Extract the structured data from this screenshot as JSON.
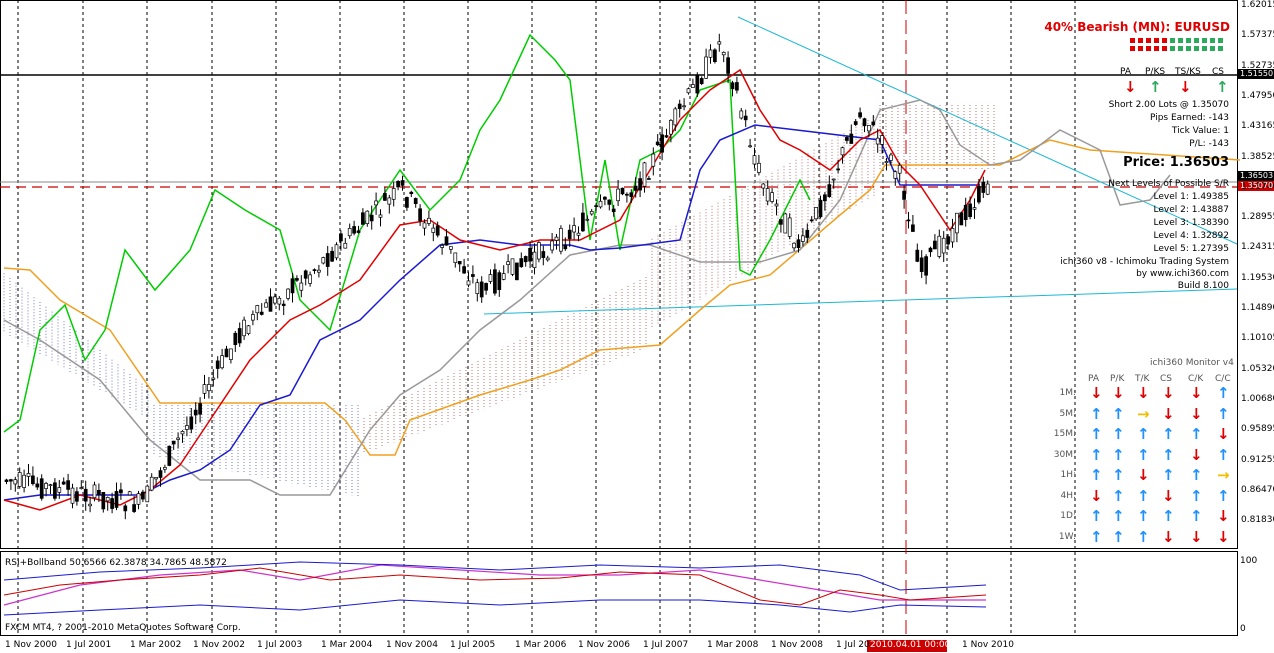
{
  "window": {
    "indicator_label": "RSI+Bollband 50.6566 62.3878 34.7865 48.5872",
    "copyright": "FXCM MT4, ? 2001-2010 MetaQuotes Software Corp.",
    "highlight_date": "2010.04.01 00:00"
  },
  "price_axis": [
    "1.62015",
    "1.57375",
    "1.52735",
    "1.47950",
    "1.43165",
    "1.38525",
    "1.33740",
    "1.28955",
    "1.24315",
    "1.19530",
    "1.14890",
    "1.10105",
    "1.05320",
    "1.00680",
    "0.95895",
    "0.91255",
    "0.86470",
    "0.81830"
  ],
  "price_tags": {
    "current": "1.36503",
    "level_black": "1.51550",
    "level_red": "1.35070"
  },
  "rsi_axis": {
    "top": "100",
    "bottom": "0"
  },
  "time_axis": [
    "1 Nov 2000",
    "1 Jul 2001",
    "1 Mar 2002",
    "1 Nov 2002",
    "1 Jul 2003",
    "1 Mar 2004",
    "1 Nov 2004",
    "1 Jul 2005",
    "1 Mar 2006",
    "1 Nov 2006",
    "1 Jul 2007",
    "1 Mar 2008",
    "1 Nov 2008",
    "1 Jul 20",
    "1 Nov 2010"
  ],
  "status_panel": {
    "headline": "40% Bearish (MN): EURUSD",
    "columns": [
      "PA",
      "P/KS",
      "TS/KS",
      "CS"
    ],
    "arrows": [
      "down",
      "up",
      "down",
      "up"
    ],
    "position": "Short 2.00 Lots @ 1.35070",
    "pips": "Pips Earned: -143",
    "tick": "Tick Value: 1",
    "pl": "P/L: -143",
    "price": "Price: 1.36503",
    "sr_title": "Next Levels of Possible S/R",
    "levels": [
      "Level 1: 1.49385",
      "Level 2: 1.43887",
      "Level 3: 1.38390",
      "Level 4: 1.32892",
      "Level 5: 1.27395"
    ],
    "system": "ichi360 v8 - Ichimoku Trading System",
    "site": "by www.ichi360.com",
    "build": "Build 8.100"
  },
  "monitor": {
    "title": "ichi360 Monitor v4",
    "columns": [
      "PA",
      "P/K",
      "T/K",
      "CS",
      "C/K",
      "C/C"
    ],
    "rows": [
      {
        "tf": "1M:",
        "arrows": [
          "down",
          "down",
          "down",
          "down",
          "down",
          "up"
        ]
      },
      {
        "tf": "5M:",
        "arrows": [
          "up",
          "up",
          "right",
          "down",
          "down",
          "up"
        ]
      },
      {
        "tf": "15M:",
        "arrows": [
          "up",
          "up",
          "up",
          "up",
          "up",
          "down"
        ]
      },
      {
        "tf": "30M:",
        "arrows": [
          "up",
          "up",
          "up",
          "up",
          "down",
          "up"
        ]
      },
      {
        "tf": "1H:",
        "arrows": [
          "up",
          "up",
          "down",
          "up",
          "up",
          "right"
        ]
      },
      {
        "tf": "4H:",
        "arrows": [
          "down",
          "up",
          "up",
          "down",
          "up",
          "up"
        ]
      },
      {
        "tf": "1D:",
        "arrows": [
          "up",
          "up",
          "up",
          "up",
          "up",
          "down"
        ]
      },
      {
        "tf": "1W:",
        "arrows": [
          "up",
          "up",
          "up",
          "down",
          "down",
          "down"
        ]
      }
    ]
  },
  "colors": {
    "up": "#1e90ff",
    "down": "#e00000",
    "right": "#f0c000",
    "panel_up": "#2aaa5a",
    "panel_down": "#e00000",
    "headline": "#e00000"
  }
}
